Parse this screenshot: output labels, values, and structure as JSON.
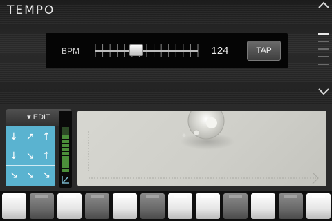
{
  "header": {
    "title": "TEMPO"
  },
  "tempo": {
    "bpm_label": "BPM",
    "bpm_value": "124",
    "tap_label": "TAP",
    "slider_level": 0.4
  },
  "navigation": {
    "up_icon": "chevron-up-icon",
    "down_icon": "chevron-down-icon",
    "page_count": 5,
    "current_page": 1
  },
  "edit": {
    "tab_label": "▾ EDIT",
    "arrows": [
      [
        "↓",
        "↗",
        "↑"
      ],
      [
        "↓",
        "↘",
        "↑"
      ],
      [
        "↘",
        "↘",
        "↘"
      ]
    ]
  },
  "meter": {
    "icon": "level-meter-icon"
  },
  "pads": {
    "count": 12,
    "states": [
      "light",
      "dark",
      "light",
      "dark",
      "light",
      "dark",
      "light",
      "light",
      "dark",
      "light",
      "dark",
      "light"
    ]
  },
  "colors": {
    "accent_blue": "#5ab3d0",
    "meter_green": "#4b8f3a",
    "xy_pad": "#d1d1cb"
  }
}
